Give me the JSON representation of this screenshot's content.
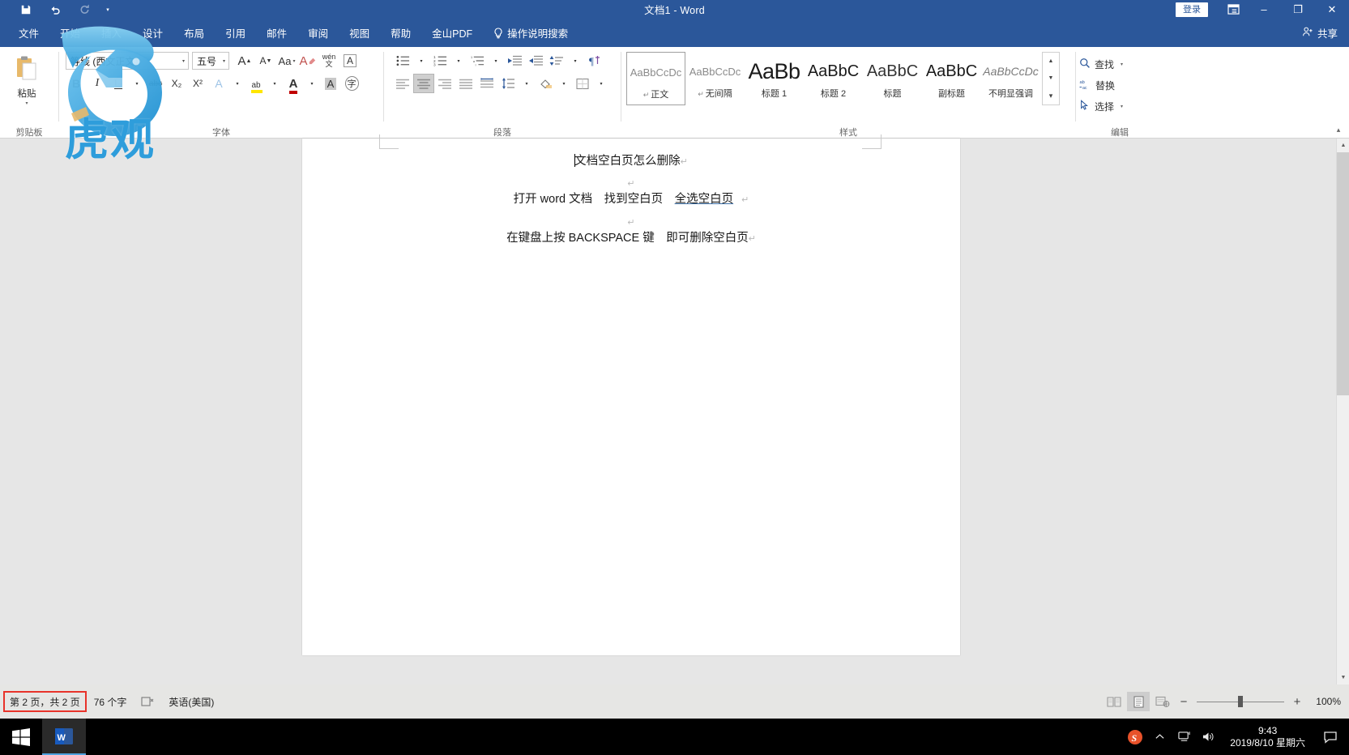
{
  "window": {
    "title": "文档1  -  Word",
    "signin_label": "登录",
    "minimize": "–",
    "restore": "❐",
    "close": "✕",
    "share_label": "共享"
  },
  "quick_access": {
    "save": "save-icon",
    "undo": "undo-icon",
    "redo": "redo-icon",
    "customize": "▾"
  },
  "tabs": [
    {
      "label": "文件"
    },
    {
      "label": "开始"
    },
    {
      "label": "插入"
    },
    {
      "label": "设计"
    },
    {
      "label": "布局"
    },
    {
      "label": "引用"
    },
    {
      "label": "邮件"
    },
    {
      "label": "审阅"
    },
    {
      "label": "视图"
    },
    {
      "label": "帮助"
    },
    {
      "label": "金山PDF"
    }
  ],
  "tellme": {
    "label": "操作说明搜索"
  },
  "ribbon": {
    "clipboard": {
      "group_label": "剪贴板",
      "paste_label": "粘贴",
      "paste_caret": "▾"
    },
    "font": {
      "group_label": "字体",
      "font_name": "等线 (西文正文)",
      "font_size": "五号",
      "grow_font": "A",
      "shrink_font": "A",
      "change_case": "Aa",
      "clear_format": "A",
      "phonetic": "拼",
      "char_border": "A",
      "bold": "B",
      "italic": "I",
      "underline": "U",
      "strikethrough": "abc",
      "subscript": "X₂",
      "superscript": "X²",
      "text_effects": "A",
      "highlight": "ab",
      "font_color": "A",
      "char_shading": "A",
      "enclose_char": "字",
      "caret": "▾"
    },
    "paragraph": {
      "group_label": "段落",
      "bullets": "bullet-list-icon",
      "numbering": "numbered-list-icon",
      "multilevel": "multilevel-list-icon",
      "decrease_indent": "decrease-indent-icon",
      "increase_indent": "increase-indent-icon",
      "sort": "sort-icon",
      "show_marks": "show-paragraph-marks-icon",
      "align_left": "align-left-icon",
      "align_center": "align-center-icon",
      "align_right": "align-right-icon",
      "justify": "justify-icon",
      "distribute": "distribute-icon",
      "line_spacing": "line-spacing-icon",
      "shading": "shading-icon",
      "borders": "borders-icon"
    },
    "styles": {
      "group_label": "样式",
      "items": [
        {
          "preview": "AaBbCcDc",
          "name": "正文",
          "pilcrow": "↵",
          "selected": true
        },
        {
          "preview": "AaBbCcDc",
          "name": "无间隔",
          "pilcrow": "↵",
          "selected": false
        },
        {
          "preview": "AaBb",
          "name": "标题 1",
          "pilcrow": "",
          "selected": false
        },
        {
          "preview": "AaBbC",
          "name": "标题 2",
          "pilcrow": "",
          "selected": false
        },
        {
          "preview": "AaBbC",
          "name": "标题",
          "pilcrow": "",
          "selected": false
        },
        {
          "preview": "AaBbC",
          "name": "副标题",
          "pilcrow": "",
          "selected": false
        },
        {
          "preview": "AaBbCcDc",
          "name": "不明显强调",
          "pilcrow": "",
          "selected": false
        }
      ],
      "scroll_up": "▲",
      "scroll_down": "▼",
      "more": "▾"
    },
    "editing": {
      "group_label": "编辑",
      "find_label": "查找",
      "find_caret": "▾",
      "replace_label": "替换",
      "select_label": "选择",
      "select_caret": "▾"
    },
    "collapse": "▴"
  },
  "document": {
    "lines": [
      {
        "text": "文档空白页怎么删除",
        "mark": "↵",
        "underline": "",
        "caret": true
      },
      {
        "text": "",
        "mark": "↵",
        "underline": "",
        "caret": false
      },
      {
        "text": "打开 word 文档　找到空白页　",
        "mark": "↵",
        "underline": "全选空白页",
        "caret": false
      },
      {
        "text": "",
        "mark": "↵",
        "underline": "",
        "caret": false
      },
      {
        "text": "在键盘上按 BACKSPACE 键　即可删除空白页",
        "mark": "↵",
        "underline": "",
        "caret": false
      }
    ]
  },
  "status_bar": {
    "page_info": "第 2 页，共 2 页",
    "word_count": "76 个字",
    "proofing": "proofing-errors-icon",
    "language": "英语(美国)",
    "view_read": "read-mode-icon",
    "view_print": "print-layout-icon",
    "view_web": "web-layout-icon",
    "zoom_out": "−",
    "zoom_in": "+",
    "zoom_level": "100%"
  },
  "taskbar": {
    "start": "windows-start-icon",
    "apps": [
      {
        "name": "word-taskbar-icon",
        "label": "W"
      }
    ],
    "tray": {
      "ime": "S",
      "chevron": "⌃",
      "network": "network-icon",
      "volume": "volume-icon",
      "time": "9:43",
      "date": "2019/8/10 星期六",
      "notifications": "notification-icon"
    }
  },
  "watermark": {
    "text": "虎观"
  },
  "colors": {
    "word_blue": "#2b579a",
    "accent_blue": "#2e9ddb",
    "highlight_red": "#e8332a",
    "doc_bg": "#e6e6e4"
  }
}
